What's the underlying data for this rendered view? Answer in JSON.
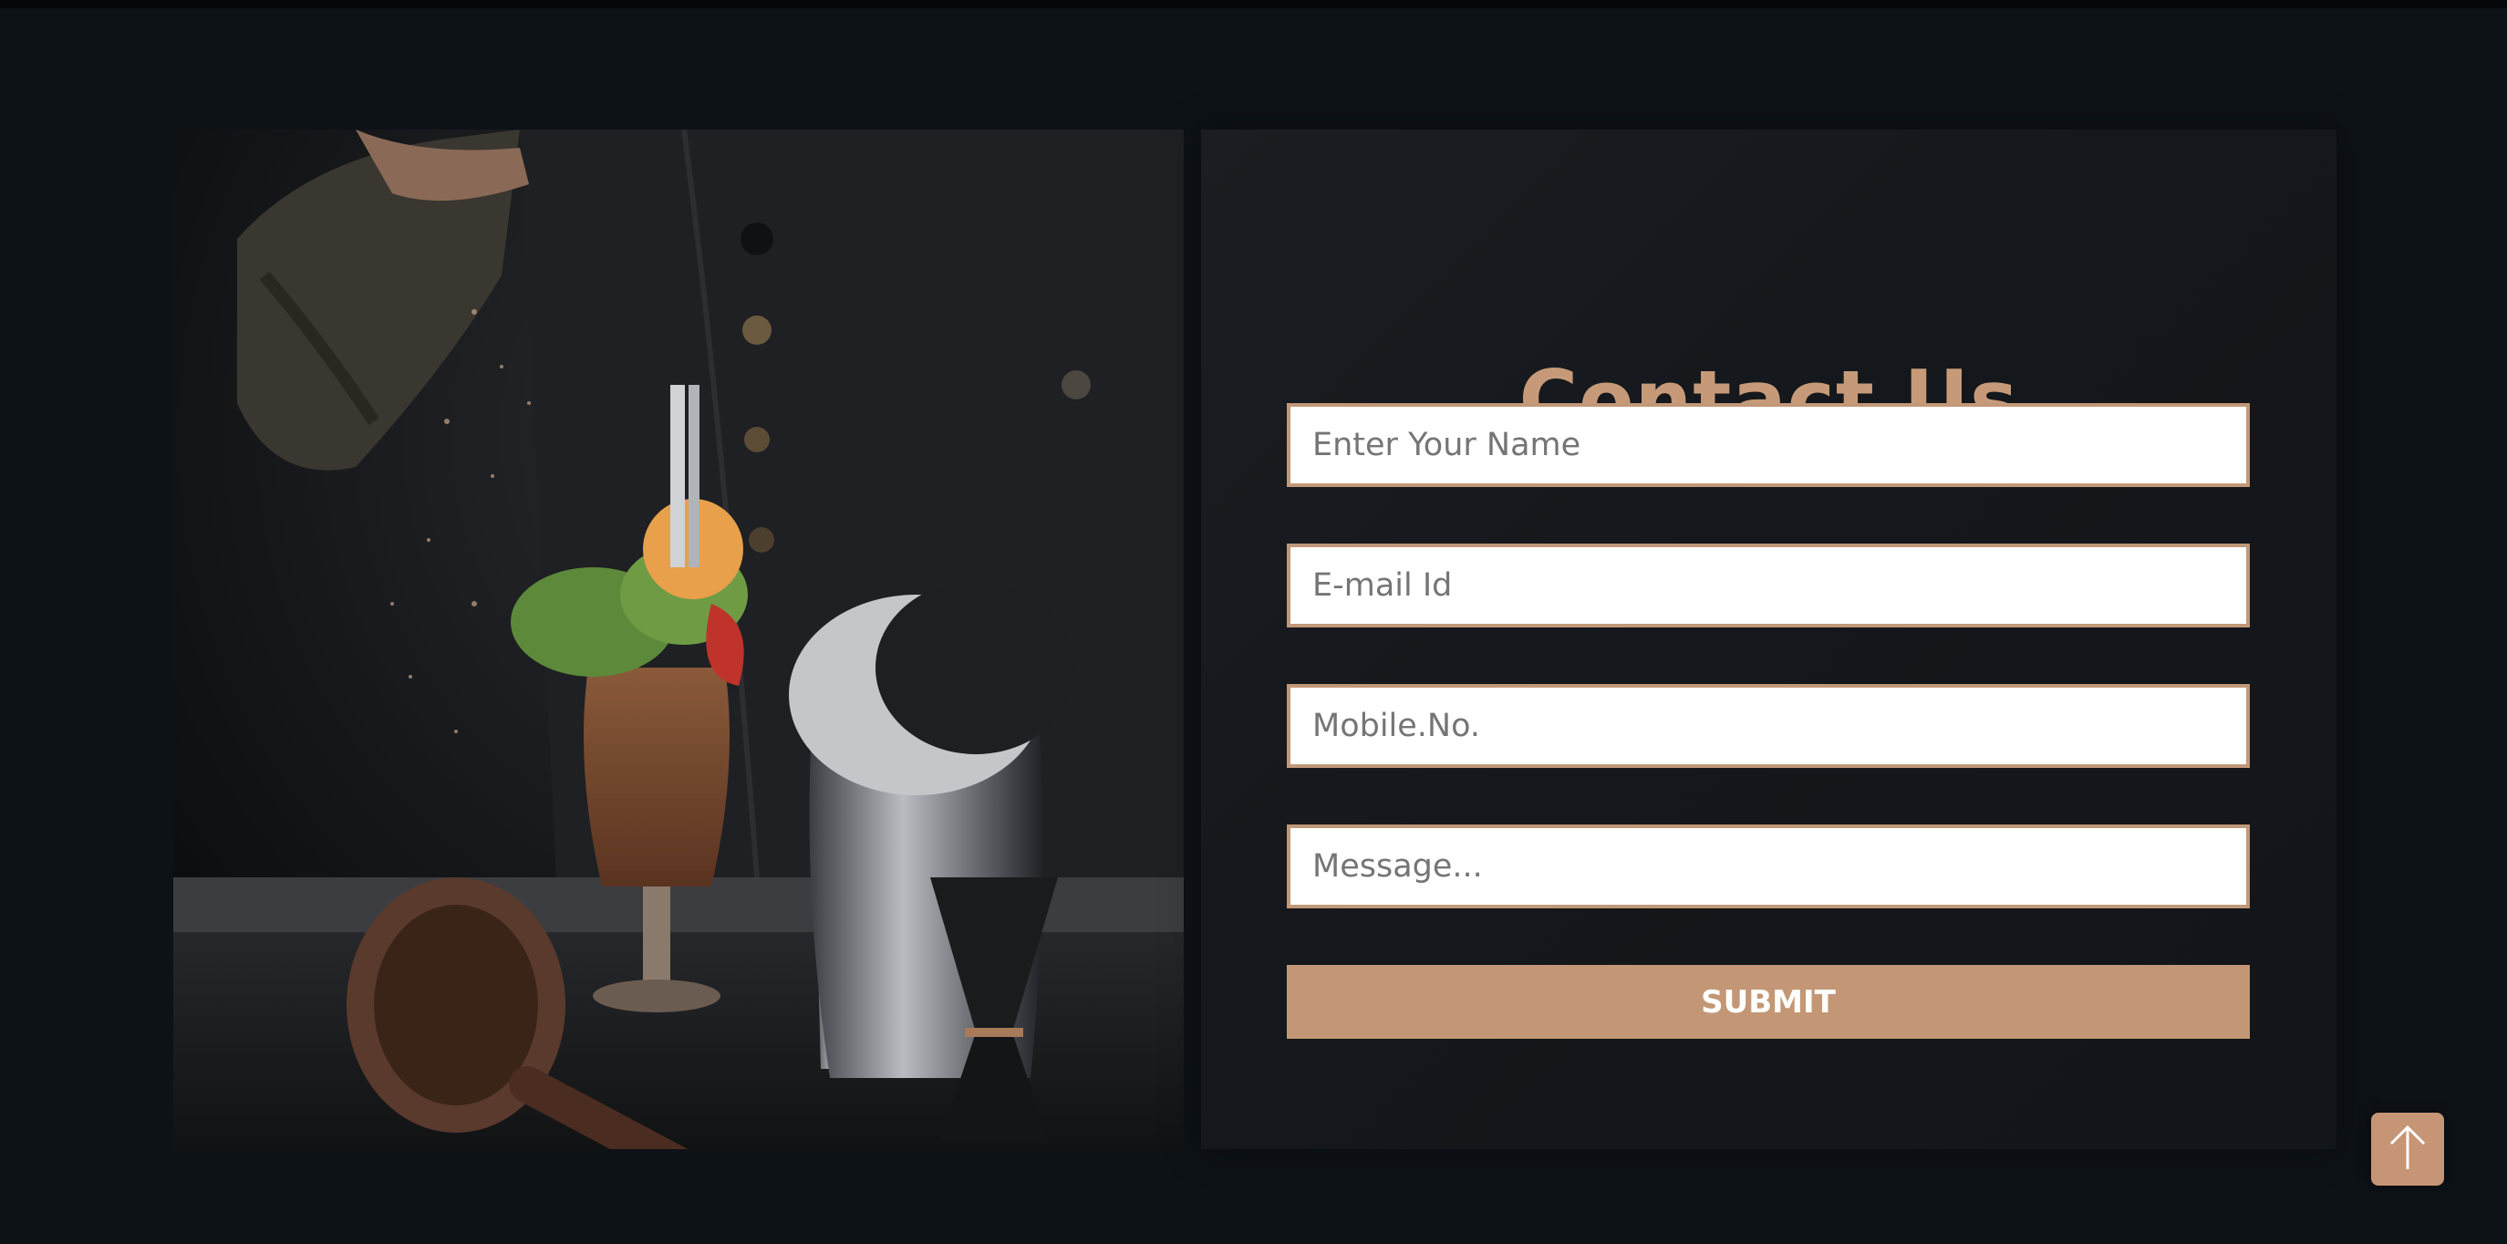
{
  "contact": {
    "title": "Contact Us",
    "name_placeholder": "Enter Your Name",
    "email_placeholder": "E-mail Id",
    "mobile_placeholder": "Mobile.No.",
    "message_placeholder": "Message...",
    "submit_label": "SUBMIT"
  },
  "icons": {
    "scroll_top": "arrow-up-icon"
  },
  "colors": {
    "accent": "#c39775",
    "background": "#0d1217",
    "panel": "#16191d"
  }
}
